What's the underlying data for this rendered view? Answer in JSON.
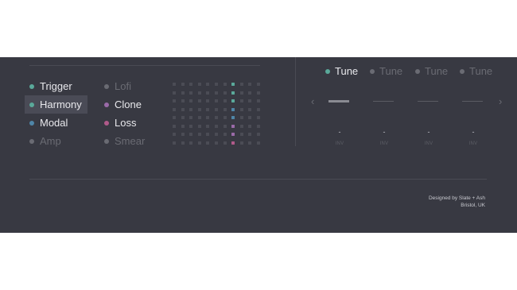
{
  "modules": [
    {
      "label": "Trigger",
      "color": "#5aa99a",
      "active": true,
      "selected": false
    },
    {
      "label": "Lofi",
      "color": "#6a6b73",
      "active": false,
      "selected": false
    },
    {
      "label": "Harmony",
      "color": "#5aa99a",
      "active": true,
      "selected": true
    },
    {
      "label": "Clone",
      "color": "#9a6aa8",
      "active": true,
      "selected": false
    },
    {
      "label": "Modal",
      "color": "#4f86a8",
      "active": true,
      "selected": false
    },
    {
      "label": "Loss",
      "color": "#b05a8a",
      "active": true,
      "selected": false
    },
    {
      "label": "Amp",
      "color": "#6a6b73",
      "active": false,
      "selected": false
    },
    {
      "label": "Smear",
      "color": "#6a6b73",
      "active": false,
      "selected": false
    }
  ],
  "grid": {
    "rows": 8,
    "cols": 11,
    "highlight_column": 7,
    "highlight_colors": [
      "#5aa99a",
      "#5aa99a",
      "#5aa99a",
      "#4f86a8",
      "#4f86a8",
      "#9a6aa8",
      "#9a6aa8",
      "#b05a8a"
    ]
  },
  "tune": {
    "tabs": [
      {
        "label": "Tune",
        "active": true
      },
      {
        "label": "Tune",
        "active": false
      },
      {
        "label": "Tune",
        "active": false
      },
      {
        "label": "Tune",
        "active": false
      }
    ],
    "sliders": [
      {
        "level": 1.0,
        "value": "-",
        "inv": "INV"
      },
      {
        "level": 0.0,
        "value": "-",
        "inv": "INV"
      },
      {
        "level": 0.0,
        "value": "-",
        "inv": "INV"
      },
      {
        "level": 0.0,
        "value": "-",
        "inv": "INV"
      }
    ],
    "prev_arrow": "‹",
    "next_arrow": "›"
  },
  "credit": {
    "line1": "Designed by Slate + Ash",
    "line2": "Bristol, UK"
  }
}
